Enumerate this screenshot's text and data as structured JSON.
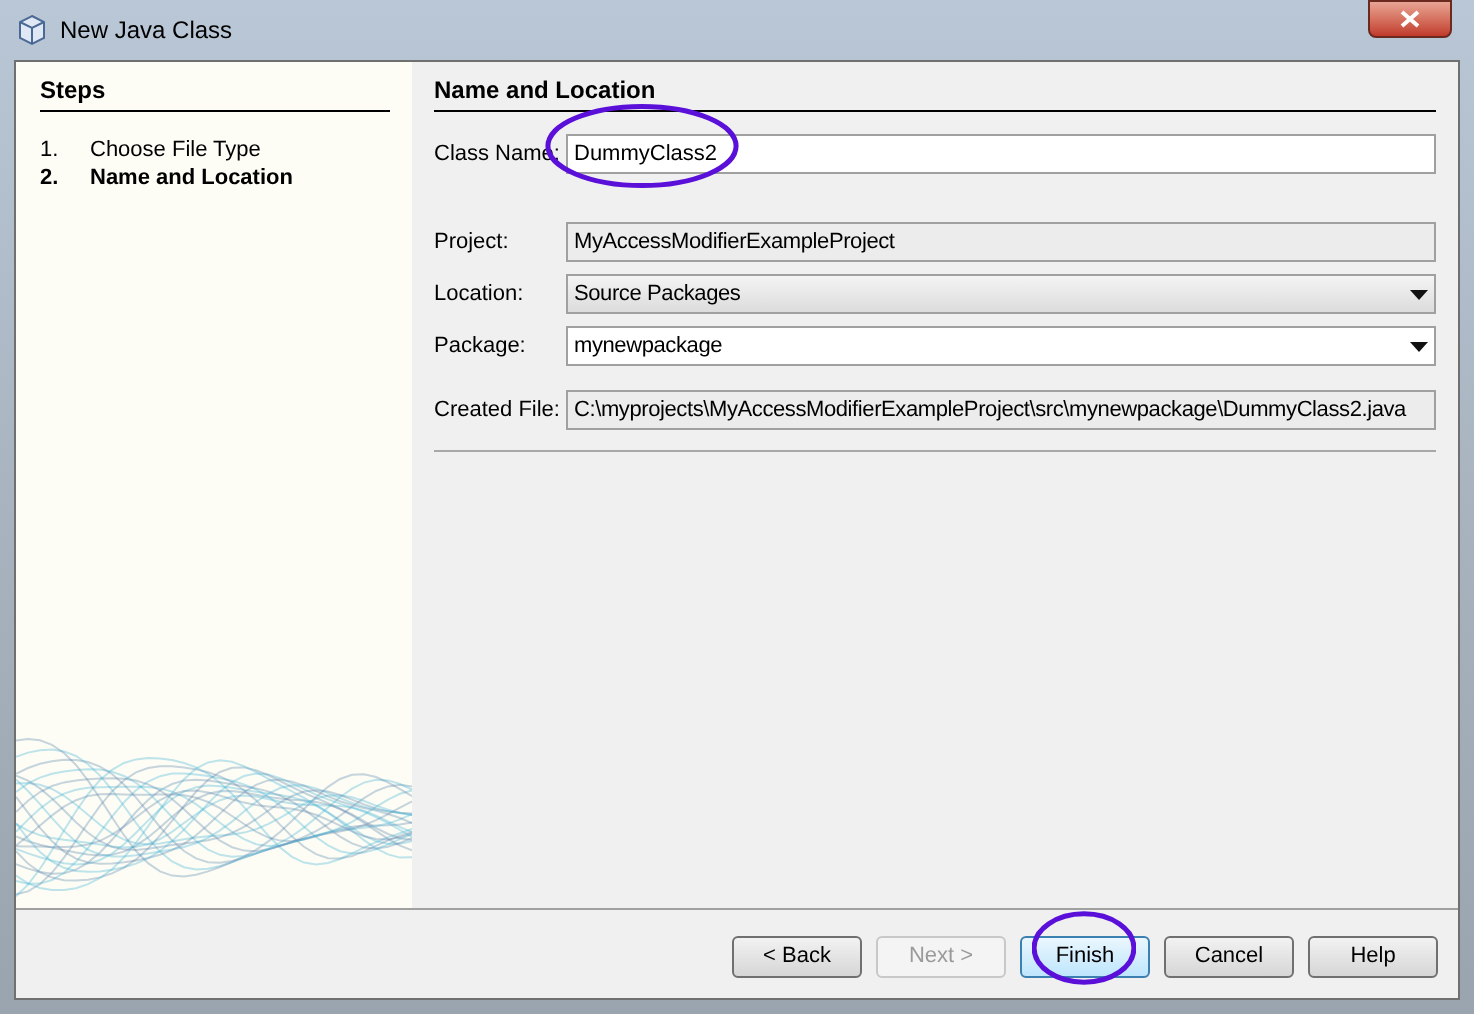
{
  "window": {
    "title": "New Java Class"
  },
  "steps": {
    "title": "Steps",
    "items": [
      {
        "number": "1.",
        "label": "Choose File Type",
        "selected": false
      },
      {
        "number": "2.",
        "label": "Name and Location",
        "selected": true
      }
    ]
  },
  "panel": {
    "title": "Name and Location",
    "class_name": {
      "label": "Class Name:",
      "value": "DummyClass2",
      "circled": true
    },
    "fields": [
      {
        "kind": "readonly",
        "label": "Project:",
        "value": "MyAccessModifierExampleProject"
      },
      {
        "kind": "combo",
        "label": "Location:",
        "value": "Source Packages"
      },
      {
        "kind": "editcombo",
        "label": "Package:",
        "value": "mynewpackage"
      },
      {
        "kind": "readonly",
        "label": "Created File:",
        "value": "C:\\myprojects\\MyAccessModifierExampleProject\\src\\mynewpackage\\DummyClass2.java"
      }
    ]
  },
  "buttons": [
    {
      "label": "< Back",
      "disabled": false,
      "default": false,
      "circled": false
    },
    {
      "label": "Next >",
      "disabled": true,
      "default": false,
      "circled": false
    },
    {
      "label": "Finish",
      "disabled": false,
      "default": true,
      "circled": true
    },
    {
      "label": "Cancel",
      "disabled": false,
      "default": false,
      "circled": false
    },
    {
      "label": "Help",
      "disabled": false,
      "default": false,
      "circled": false
    }
  ]
}
